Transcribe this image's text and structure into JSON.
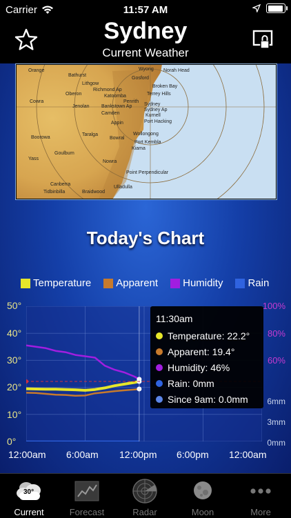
{
  "status_bar": {
    "carrier": "Carrier",
    "time": "11:57 AM"
  },
  "header": {
    "city": "Sydney",
    "subtitle": "Current Weather"
  },
  "map": {
    "places": [
      "Orange",
      "Bathurst",
      "Lithgow",
      "Wyong",
      "Norah Head",
      "Gosford",
      "Broken Bay",
      "Richmond Ap",
      "Terrey Hills",
      "Oberon",
      "Katoomba",
      "Cowra",
      "Jenolan",
      "Penrith",
      "Bankstown Ap",
      "Sydney",
      "Sydney Ap",
      "Kurnell",
      "Camden",
      "Port Hacking",
      "Appin",
      "Goulburn",
      "Taralga",
      "Wollongong",
      "Boorowa",
      "Bowral",
      "Port Kembla",
      "Kiama",
      "Yass",
      "Nowra",
      "Point Perpendicular",
      "Canberra",
      "Braidwood",
      "Ulladulla",
      "Tidbinbilla"
    ]
  },
  "chart": {
    "title": "Today's Chart",
    "legend": [
      {
        "label": "Temperature",
        "color": "#e6e62a"
      },
      {
        "label": "Apparent",
        "color": "#c77a2c"
      },
      {
        "label": "Humidity",
        "color": "#a11ee0"
      },
      {
        "label": "Rain",
        "color": "#2f63e0"
      }
    ],
    "y_left_ticks": [
      "50°",
      "40°",
      "30°",
      "20°",
      "10°",
      "0°"
    ],
    "y_right_pct": [
      "100%",
      "80%",
      "60%"
    ],
    "y_right_mm": [
      "6mm",
      "3mm",
      "0mm"
    ],
    "x_ticks": [
      "12:00am",
      "6:00am",
      "12:00pm",
      "6:00pm",
      "12:00am"
    ]
  },
  "chart_data": {
    "type": "line",
    "x": [
      "0:00",
      "1:00",
      "2:00",
      "3:00",
      "4:00",
      "5:00",
      "6:00",
      "7:00",
      "8:00",
      "9:00",
      "10:00",
      "11:00",
      "11:30"
    ],
    "series": [
      {
        "name": "Temperature",
        "unit": "°",
        "values": [
          19.5,
          19.4,
          19.3,
          19.3,
          19.2,
          19.1,
          18.9,
          19.2,
          19.8,
          20.6,
          21.2,
          21.8,
          22.2
        ]
      },
      {
        "name": "Apparent",
        "unit": "°",
        "values": [
          18.0,
          17.9,
          17.6,
          17.3,
          17.2,
          16.9,
          17.0,
          17.8,
          18.2,
          18.6,
          18.9,
          19.2,
          19.4
        ]
      },
      {
        "name": "Humidity",
        "unit": "%",
        "values": [
          71,
          70,
          69,
          67,
          66,
          64,
          63,
          62,
          56,
          53,
          51,
          48,
          46
        ]
      },
      {
        "name": "Rain",
        "unit": "mm",
        "values": [
          0,
          0,
          0,
          0,
          0,
          0,
          0,
          0,
          0,
          0,
          0,
          0,
          0
        ]
      }
    ],
    "y_left_range": [
      0,
      50
    ],
    "y_right_pct_range": [
      0,
      100
    ],
    "y_right_mm_range": [
      0,
      6
    ],
    "x_range_hours": [
      0,
      24
    ]
  },
  "tooltip": {
    "time": "11:30am",
    "rows": [
      {
        "text": "Temperature: 22.2°",
        "color": "#e6e62a"
      },
      {
        "text": "Apparent: 19.4°",
        "color": "#c77a2c"
      },
      {
        "text": "Humidity: 46%",
        "color": "#a11ee0"
      },
      {
        "text": "Rain: 0mm",
        "color": "#2f63e0"
      },
      {
        "text": "Since 9am: 0.0mm",
        "color": "#5c86e8"
      }
    ]
  },
  "tabs": [
    {
      "label": "Current",
      "icon": "cloud-icon",
      "badge": "30°",
      "active": true
    },
    {
      "label": "Forecast",
      "icon": "graph-icon",
      "active": false
    },
    {
      "label": "Radar",
      "icon": "radar-icon",
      "active": false
    },
    {
      "label": "Moon",
      "icon": "moon-icon",
      "active": false
    },
    {
      "label": "More",
      "icon": "more-icon",
      "active": false
    }
  ]
}
